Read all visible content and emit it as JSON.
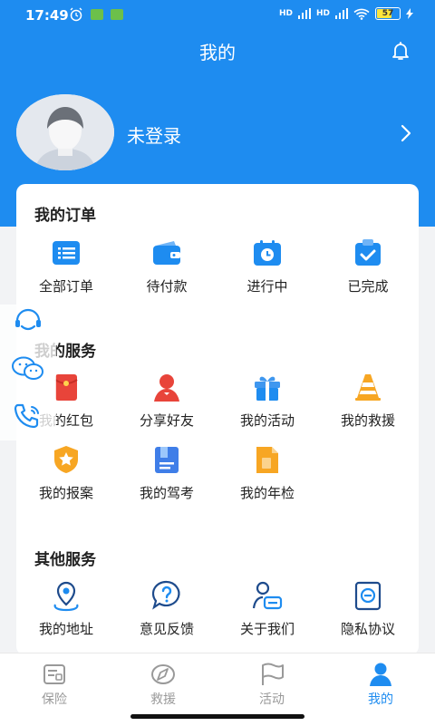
{
  "status_bar": {
    "time": "17:49",
    "battery": "57",
    "network_1": "HD",
    "network_2": "HD"
  },
  "header": {
    "title": "我的"
  },
  "profile": {
    "login_text": "未登录"
  },
  "orders": {
    "title": "我的订单",
    "items": [
      {
        "label": "全部订单",
        "icon": "list-icon"
      },
      {
        "label": "待付款",
        "icon": "wallet-icon"
      },
      {
        "label": "进行中",
        "icon": "clock-icon"
      },
      {
        "label": "已完成",
        "icon": "check-clipboard-icon"
      }
    ]
  },
  "services": {
    "title": "我的服务",
    "items": [
      {
        "label": "我的红包",
        "icon": "red-packet-icon"
      },
      {
        "label": "分享好友",
        "icon": "share-friend-icon"
      },
      {
        "label": "我的活动",
        "icon": "gift-icon"
      },
      {
        "label": "我的救援",
        "icon": "traffic-cone-icon"
      },
      {
        "label": "我的报案",
        "icon": "star-shield-icon"
      },
      {
        "label": "我的驾考",
        "icon": "book-icon"
      },
      {
        "label": "我的年检",
        "icon": "document-icon"
      }
    ]
  },
  "other": {
    "title": "其他服务",
    "items": [
      {
        "label": "我的地址",
        "icon": "location-icon"
      },
      {
        "label": "意见反馈",
        "icon": "question-icon"
      },
      {
        "label": "关于我们",
        "icon": "person-card-icon"
      },
      {
        "label": "隐私协议",
        "icon": "privacy-icon"
      }
    ]
  },
  "tabs": [
    {
      "label": "保险",
      "icon": "insurance-icon",
      "active": false
    },
    {
      "label": "救援",
      "icon": "compass-icon",
      "active": false
    },
    {
      "label": "活动",
      "icon": "flag-icon",
      "active": false
    },
    {
      "label": "我的",
      "icon": "profile-icon",
      "active": true
    }
  ],
  "colors": {
    "primary": "#1e8cf0",
    "orange": "#f7a623",
    "red": "#e8443a",
    "background": "#f2f3f5"
  }
}
